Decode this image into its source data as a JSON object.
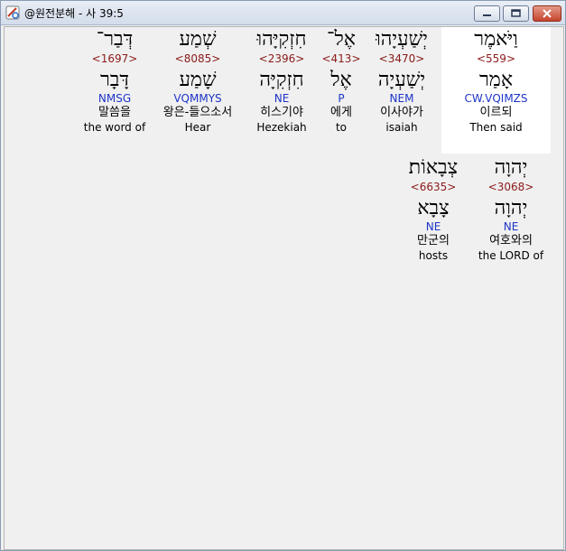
{
  "window": {
    "title": "@원전분해 - 사 39:5"
  },
  "line1": [
    {
      "heb": "וַיֹּאמֶר",
      "strong": "<559>",
      "lemma": "אָמַר",
      "morph": "CW.VQIMZS",
      "kor": "이르되",
      "eng": "Then said"
    },
    {
      "heb": "יְשַׁעְיָהוּ",
      "strong": "<3470>",
      "lemma": "יְשַׁעְיָה",
      "morph": "NEM",
      "kor": "이사야가",
      "eng": "isaiah"
    },
    {
      "heb": "אֶל־",
      "strong": "<413>",
      "lemma": "אֶל",
      "morph": "P",
      "kor": "에게",
      "eng": "to"
    },
    {
      "heb": "חִזְקִיָּהוּ",
      "strong": "<2396>",
      "lemma": "חִזְקִיָּה",
      "morph": "NE",
      "kor": "히스기야",
      "eng": "Hezekiah"
    },
    {
      "heb": "שְׁמַע",
      "strong": "<8085>",
      "lemma": "שָׁמַע",
      "morph": "VQMMYS",
      "kor": "왕은-들으소서",
      "eng": "Hear"
    },
    {
      "heb": "דְּבַר־",
      "strong": "<1697>",
      "lemma": "דָּבָר",
      "morph": "NMSG",
      "kor": "말씀을",
      "eng": "the word of"
    }
  ],
  "line2": [
    {
      "heb": "יְהוָה",
      "strong": "<3068>",
      "lemma": "יְהוָה",
      "morph": "NE",
      "kor": "여호와의",
      "eng": "the LORD of"
    },
    {
      "heb": "צְבָאוֹת׃",
      "strong": "<6635>",
      "lemma": "צָבָא",
      "morph": "NE",
      "kor": "만군의",
      "eng": "hosts"
    }
  ]
}
